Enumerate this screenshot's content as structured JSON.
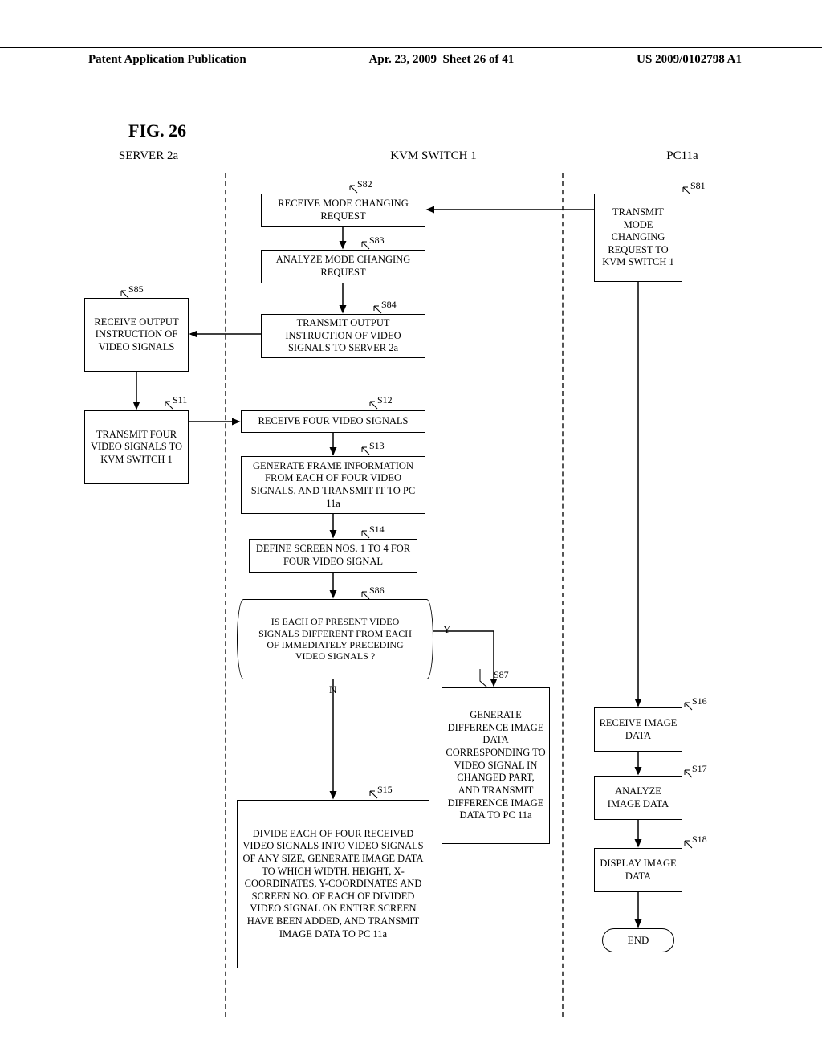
{
  "header": {
    "left": "Patent Application Publication",
    "center": "Apr. 23, 2009  Sheet 26 of 41",
    "right": "US 2009/0102798 A1"
  },
  "figure_label": "FIG. 26",
  "columns": {
    "server": "SERVER 2a",
    "kvm": "KVM SWITCH 1",
    "pc": "PC11a"
  },
  "steps": {
    "s81": {
      "id": "S81",
      "text": "TRANSMIT MODE CHANGING REQUEST TO KVM SWITCH 1"
    },
    "s82": {
      "id": "S82",
      "text": "RECEIVE MODE CHANGING REQUEST"
    },
    "s83": {
      "id": "S83",
      "text": "ANALYZE MODE CHANGING REQUEST"
    },
    "s84": {
      "id": "S84",
      "text": "TRANSMIT OUTPUT INSTRUCTION OF VIDEO SIGNALS TO SERVER 2a"
    },
    "s85": {
      "id": "S85",
      "text": "RECEIVE OUTPUT INSTRUCTION OF VIDEO SIGNALS"
    },
    "s11": {
      "id": "S11",
      "text": "TRANSMIT FOUR VIDEO SIGNALS TO KVM SWITCH 1"
    },
    "s12": {
      "id": "S12",
      "text": "RECEIVE FOUR VIDEO SIGNALS"
    },
    "s13": {
      "id": "S13",
      "text": "GENERATE FRAME INFORMATION FROM EACH OF FOUR VIDEO SIGNALS, AND TRANSMIT IT TO PC 11a"
    },
    "s14": {
      "id": "S14",
      "text": "DEFINE SCREEN NOS. 1 TO 4 FOR FOUR VIDEO SIGNAL"
    },
    "s86": {
      "id": "S86",
      "text": "IS EACH OF PRESENT VIDEO SIGNALS DIFFERENT FROM EACH OF IMMEDIATELY PRECEDING VIDEO SIGNALS ?"
    },
    "s87": {
      "id": "S87",
      "text": "GENERATE DIFFERENCE IMAGE DATA CORRESPONDING TO VIDEO SIGNAL IN CHANGED PART, AND TRANSMIT DIFFERENCE IMAGE DATA TO PC 11a"
    },
    "s15": {
      "id": "S15",
      "text": "DIVIDE EACH OF FOUR RECEIVED VIDEO SIGNALS INTO VIDEO SIGNALS OF ANY SIZE, GENERATE IMAGE DATA TO WHICH WIDTH, HEIGHT, X-COORDINATES, Y-COORDINATES AND SCREEN NO. OF EACH OF DIVIDED VIDEO SIGNAL ON ENTIRE SCREEN HAVE BEEN ADDED, AND TRANSMIT IMAGE DATA TO PC 11a"
    },
    "s16": {
      "id": "S16",
      "text": "RECEIVE IMAGE DATA"
    },
    "s17": {
      "id": "S17",
      "text": "ANALYZE IMAGE DATA"
    },
    "s18": {
      "id": "S18",
      "text": "DISPLAY IMAGE DATA"
    },
    "end": {
      "text": "END"
    }
  },
  "branches": {
    "yes": "Y",
    "no": "N"
  }
}
